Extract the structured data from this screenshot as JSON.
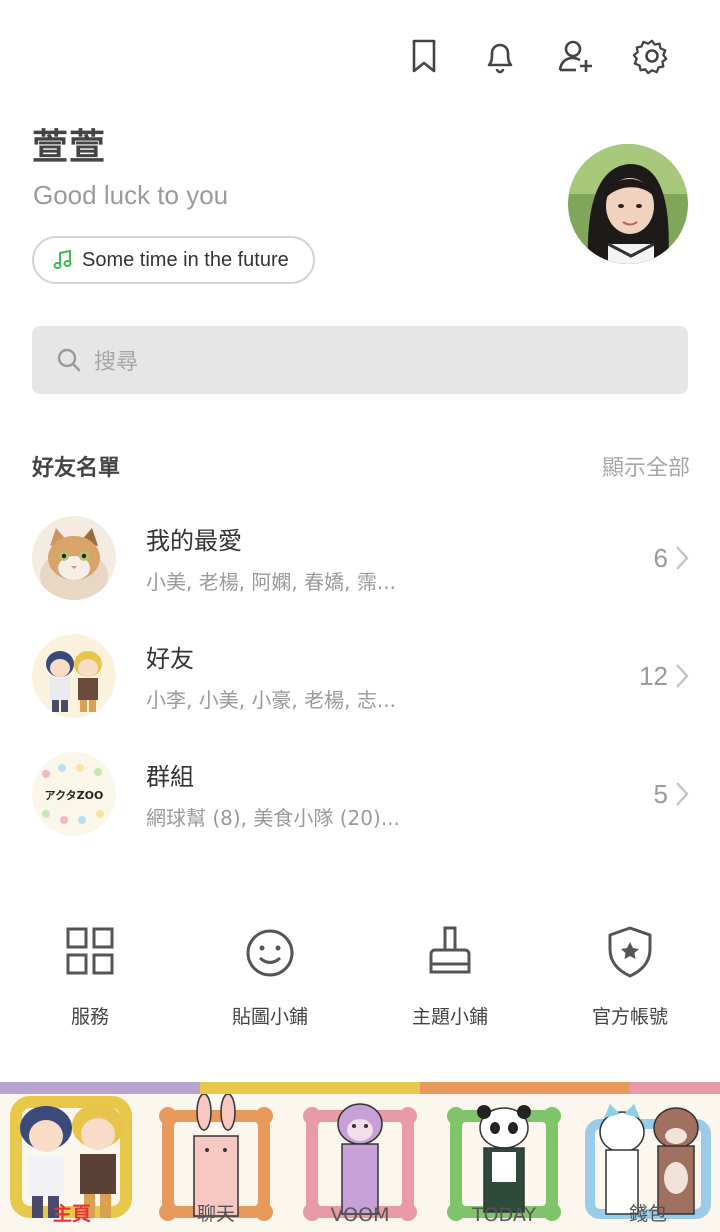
{
  "header": {
    "icons": [
      "bookmark-icon",
      "bell-icon",
      "add-friend-icon",
      "gear-icon"
    ]
  },
  "profile": {
    "name": "萱萱",
    "status": "Good luck to you",
    "music": "Some time in the future"
  },
  "search": {
    "placeholder": "搜尋"
  },
  "friends": {
    "title": "好友名單",
    "show_all": "顯示全部",
    "groups": [
      {
        "name": "我的最愛",
        "members": "小美, 老楊, 阿嫻, 春嬌, 霈...",
        "count": "6"
      },
      {
        "name": "好友",
        "members": "小李, 小美, 小豪, 老楊, 志...",
        "count": "12"
      },
      {
        "name": "群組",
        "members": "網球幫 (8), 美食小隊 (20)...",
        "count": "5"
      }
    ],
    "group_thumb_text": "アクタZOO"
  },
  "shortcuts": [
    {
      "label": "服務",
      "icon": "grid-icon"
    },
    {
      "label": "貼圖小鋪",
      "icon": "smiley-icon"
    },
    {
      "label": "主題小鋪",
      "icon": "brush-icon"
    },
    {
      "label": "官方帳號",
      "icon": "shield-star-icon"
    }
  ],
  "tabbar": {
    "colors": [
      "#b8a3cf",
      "#e8c84a",
      "#e89a5c",
      "#e89aa8"
    ],
    "tabs": [
      {
        "label": "主頁",
        "active": true
      },
      {
        "label": "聊天",
        "active": false
      },
      {
        "label": "VOOM",
        "active": false
      },
      {
        "label": "TODAY",
        "active": false
      },
      {
        "label": "錢包",
        "active": false
      }
    ]
  }
}
